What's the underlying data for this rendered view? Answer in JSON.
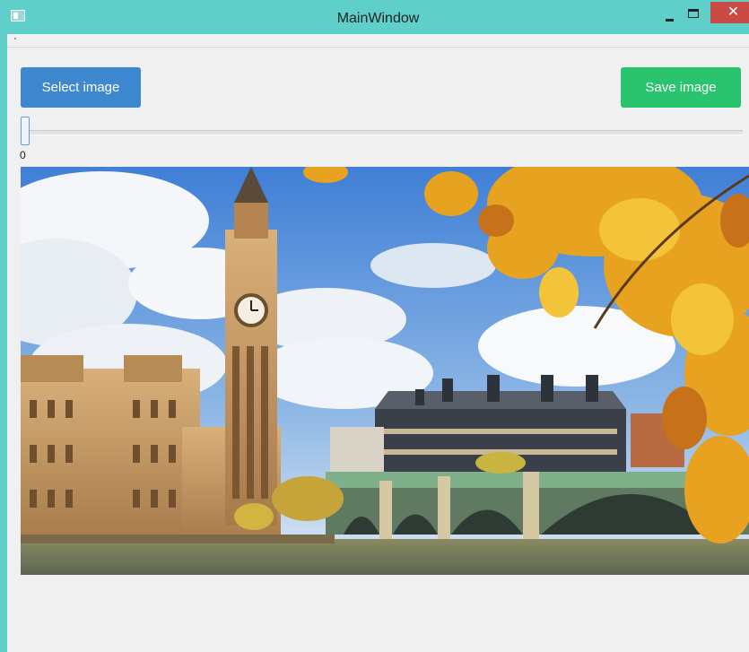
{
  "window": {
    "title": "MainWindow",
    "close_glyph": "✕"
  },
  "toolbar": {
    "select_label": "Select image",
    "save_label": "Save image"
  },
  "slider": {
    "value": "0"
  },
  "image": {
    "subject": "London skyline with Big Ben, Houses of Parliament and Westminster Bridge under autumn leaves"
  },
  "colors": {
    "titlebar": "#5ecfc9",
    "select_button": "#3d88cf",
    "save_button": "#29c46d",
    "close_button": "#c94b43"
  }
}
